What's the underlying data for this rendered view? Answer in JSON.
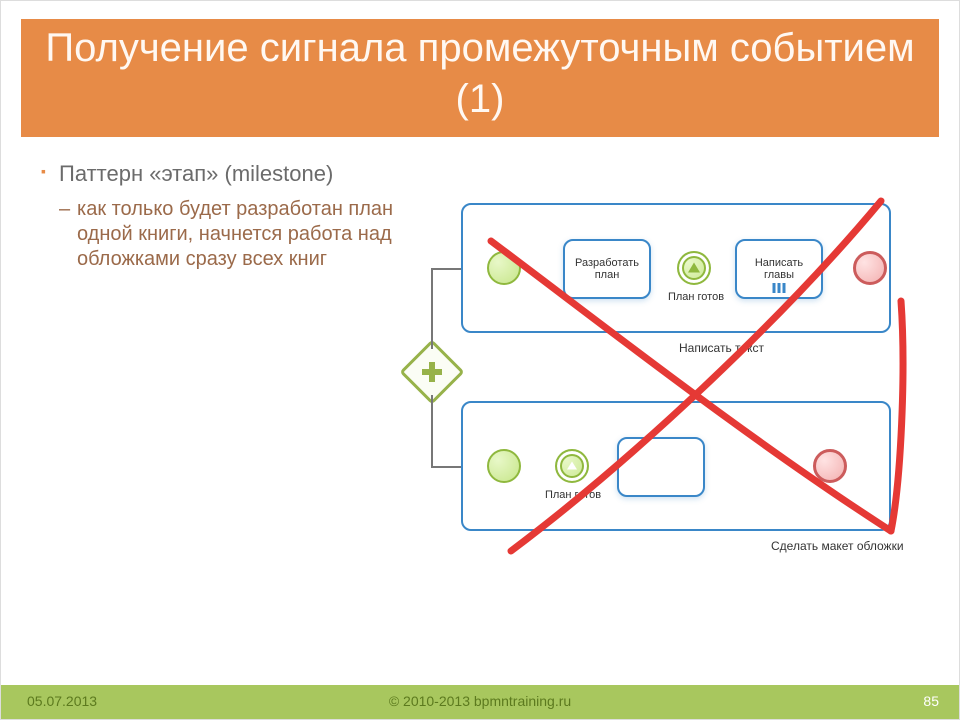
{
  "title": "Получение сигнала промежуточным событием (1)",
  "bullets": {
    "l1": "Паттерн «этап» (milestone)",
    "l2": "как только будет разработан план одной книги, начнется работа над обложками сразу всех книг"
  },
  "diagram": {
    "pool_top_label": "Написать текст",
    "pool_bot_label": "Сделать макет обложки",
    "task_plan": "Разработать план",
    "task_chapters": "Написать главы",
    "evt_plan_ready_top": "План готов",
    "evt_plan_ready_bot": "План готов"
  },
  "footer": {
    "date": "05.07.2013",
    "copyright": "© 2010-2013 bpmntraining.ru",
    "page": "85"
  }
}
